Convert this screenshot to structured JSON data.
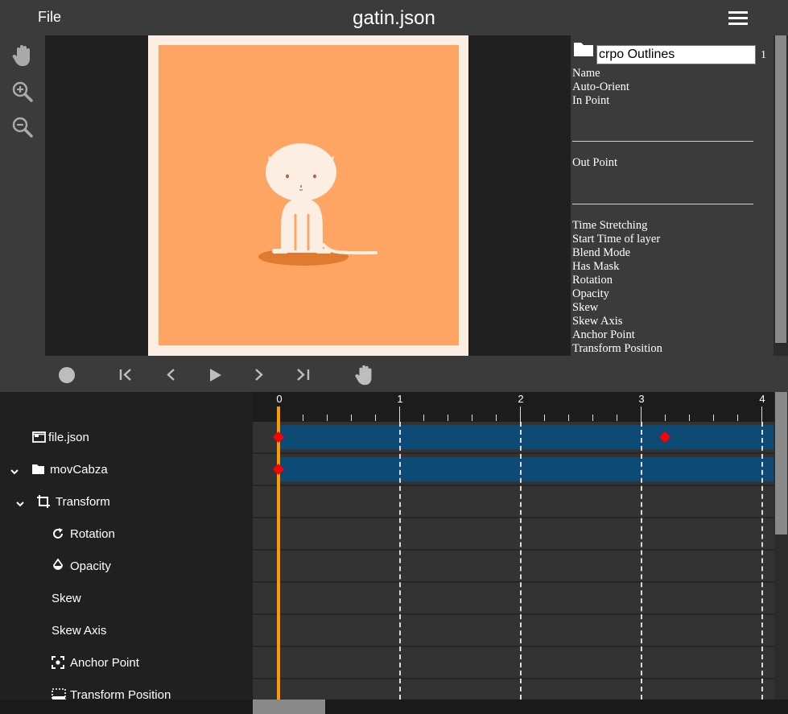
{
  "header": {
    "file_label": "File",
    "title": "gatin.json"
  },
  "tools": [
    "hand-icon",
    "zoom-in-icon",
    "zoom-out-icon"
  ],
  "colors": {
    "artboard_bg": "#ffa563",
    "artboard_frame": "#fdeee3",
    "bar": "#0d4a75",
    "keyframe": "#ff0000",
    "playhead": "#ff9900"
  },
  "properties": {
    "layer_name_value": "crpo Outlines",
    "layer_index": "1",
    "name_label": "Name",
    "auto_orient_label": "Auto-Orient",
    "in_point_label": "In Point",
    "out_point_label": "Out Point",
    "time_stretching_label": "Time Stretching",
    "start_time_label": "Start Time of layer",
    "blend_mode_label": "Blend Mode",
    "has_mask_label": "Has Mask",
    "rotation_label": "Rotation",
    "opacity_label": "Opacity",
    "skew_label": "Skew",
    "skew_axis_label": "Skew Axis",
    "anchor_point_label": "Anchor Point",
    "transform_position_label": "Transform Position"
  },
  "transport": [
    "record-icon",
    "go-to-start-icon",
    "previous-frame-icon",
    "play-icon",
    "next-frame-icon",
    "go-to-end-icon",
    "pan-icon"
  ],
  "layers": [
    {
      "label": "file.json"
    },
    {
      "label": "movCabza"
    },
    {
      "label": "Transform"
    },
    {
      "label": "Rotation"
    },
    {
      "label": "Opacity"
    },
    {
      "label": "Skew"
    },
    {
      "label": "Skew Axis"
    },
    {
      "label": "Anchor Point"
    },
    {
      "label": "Transform Position"
    }
  ],
  "timeline": {
    "ticks": [
      "0",
      "1",
      "2",
      "3",
      "4"
    ],
    "playhead_time": 0,
    "tracks": [
      {
        "bar_start": 0,
        "bar_end": 4.1,
        "keyframes": [
          0,
          3.2
        ]
      },
      {
        "bar_start": 0,
        "bar_end": 4.1,
        "keyframes": [
          0
        ]
      }
    ]
  }
}
